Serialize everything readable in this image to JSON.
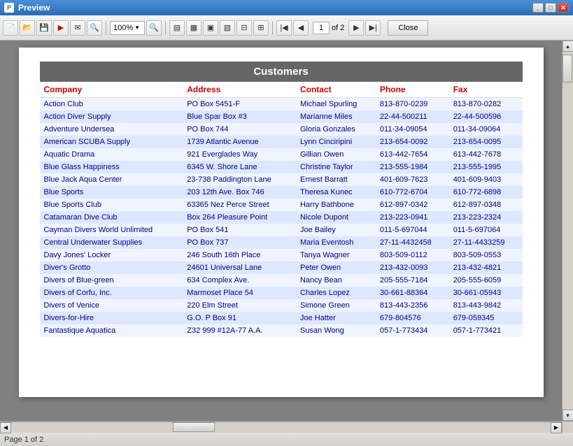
{
  "window": {
    "title": "Preview"
  },
  "toolbar": {
    "zoom_value": "100%",
    "page_current": "1",
    "page_total": "2",
    "close_label": "Close"
  },
  "report": {
    "title": "Customers",
    "columns": [
      "Company",
      "Address",
      "Contact",
      "Phone",
      "Fax"
    ],
    "rows": [
      {
        "company": "Action Club",
        "address": "PO Box 5451-F",
        "contact": "Michael Spurling",
        "phone": "813-870-0239",
        "fax": "813-870-0282",
        "highlight": false
      },
      {
        "company": "Action Diver Supply",
        "address": "Blue Spar Box #3",
        "contact": "Marianne Miles",
        "phone": "22-44-500211",
        "fax": "22-44-500596",
        "highlight": true
      },
      {
        "company": "Adventure Undersea",
        "address": "PO Box 744",
        "contact": "Gloria Gonzales",
        "phone": "011-34-09054",
        "fax": "011-34-09064",
        "highlight": false
      },
      {
        "company": "American SCUBA Supply",
        "address": "1739 Atlantic Avenue",
        "contact": "Lynn Cinciripini",
        "phone": "213-654-0092",
        "fax": "213-654-0095",
        "highlight": true
      },
      {
        "company": "Aquatic Drama",
        "address": "921 Everglades Way",
        "contact": "Gillian Owen",
        "phone": "613-442-7654",
        "fax": "613-442-7678",
        "highlight": false
      },
      {
        "company": "Blue Glass Happiness",
        "address": "6345 W. Shore Lane",
        "contact": "Christine Taylor",
        "phone": "213-555-1984",
        "fax": "213-555-1995",
        "highlight": true
      },
      {
        "company": "Blue Jack Aqua Center",
        "address": "23-738 Paddington Lane",
        "contact": "Ernest Barratt",
        "phone": "401-609-7623",
        "fax": "401-609-9403",
        "highlight": false
      },
      {
        "company": "Blue Sports",
        "address": "203 12th Ave. Box 746",
        "contact": "Theresa Kunec",
        "phone": "610-772-6704",
        "fax": "610-772-6898",
        "highlight": true
      },
      {
        "company": "Blue Sports Club",
        "address": "63365 Nez Perce Street",
        "contact": "Harry Bathbone",
        "phone": "612-897-0342",
        "fax": "612-897-0348",
        "highlight": false
      },
      {
        "company": "Catamaran Dive Club",
        "address": "Box 264 Pleasure Point",
        "contact": "Nicole Dupont",
        "phone": "213-223-0941",
        "fax": "213-223-2324",
        "highlight": true
      },
      {
        "company": "Cayman Divers World Unlimited",
        "address": "PO Box 541",
        "contact": "Joe Bailey",
        "phone": "011-5-697044",
        "fax": "011-5-697064",
        "highlight": false
      },
      {
        "company": "Central Underwater Supplies",
        "address": "PO Box 737",
        "contact": "Maria Eventosh",
        "phone": "27-11-4432458",
        "fax": "27-11-4433259",
        "highlight": true
      },
      {
        "company": "Davy Jones' Locker",
        "address": "246 South 16th Place",
        "contact": "Tanya Wagner",
        "phone": "803-509-0112",
        "fax": "803-509-0553",
        "highlight": false
      },
      {
        "company": "Diver's Grotto",
        "address": "24601 Universal Lane",
        "contact": "Peter Owen",
        "phone": "213-432-0093",
        "fax": "213-432-4821",
        "highlight": true
      },
      {
        "company": "Divers of Blue-green",
        "address": "634 Complex Ave.",
        "contact": "Nancy Bean",
        "phone": "205-555-7184",
        "fax": "205-555-6059",
        "highlight": false
      },
      {
        "company": "Divers of Corfu, Inc.",
        "address": "Marmoset Place 54",
        "contact": "Charles Lopez",
        "phone": "30-661-88364",
        "fax": "30-661-05943",
        "highlight": true
      },
      {
        "company": "Divers of Venice",
        "address": "220 Elm Street",
        "contact": "Simone Green",
        "phone": "813-443-2356",
        "fax": "813-443-9842",
        "highlight": false
      },
      {
        "company": "Divers-for-Hire",
        "address": "G.O. P Box 91",
        "contact": "Joe Hatter",
        "phone": "679-804576",
        "fax": "679-059345",
        "highlight": true
      },
      {
        "company": "Fantastique Aquatica",
        "address": "Z32 999 #12A-77 A.A.",
        "contact": "Susan Wong",
        "phone": "057-1-773434",
        "fax": "057-1-773421",
        "highlight": false
      }
    ]
  },
  "statusbar": {
    "page_info": "Page 1 of 2"
  },
  "scrollbar": {
    "h_visible": true
  },
  "icons": {
    "new": "📄",
    "open": "📂",
    "save": "💾",
    "pdf": "📕",
    "mail": "✉",
    "find": "🔍",
    "zoom_out": "🔎",
    "zoom_in": "🔍",
    "print": "🖨",
    "first": "⏮",
    "prev": "◀",
    "next": "▶",
    "last": "⏭"
  }
}
